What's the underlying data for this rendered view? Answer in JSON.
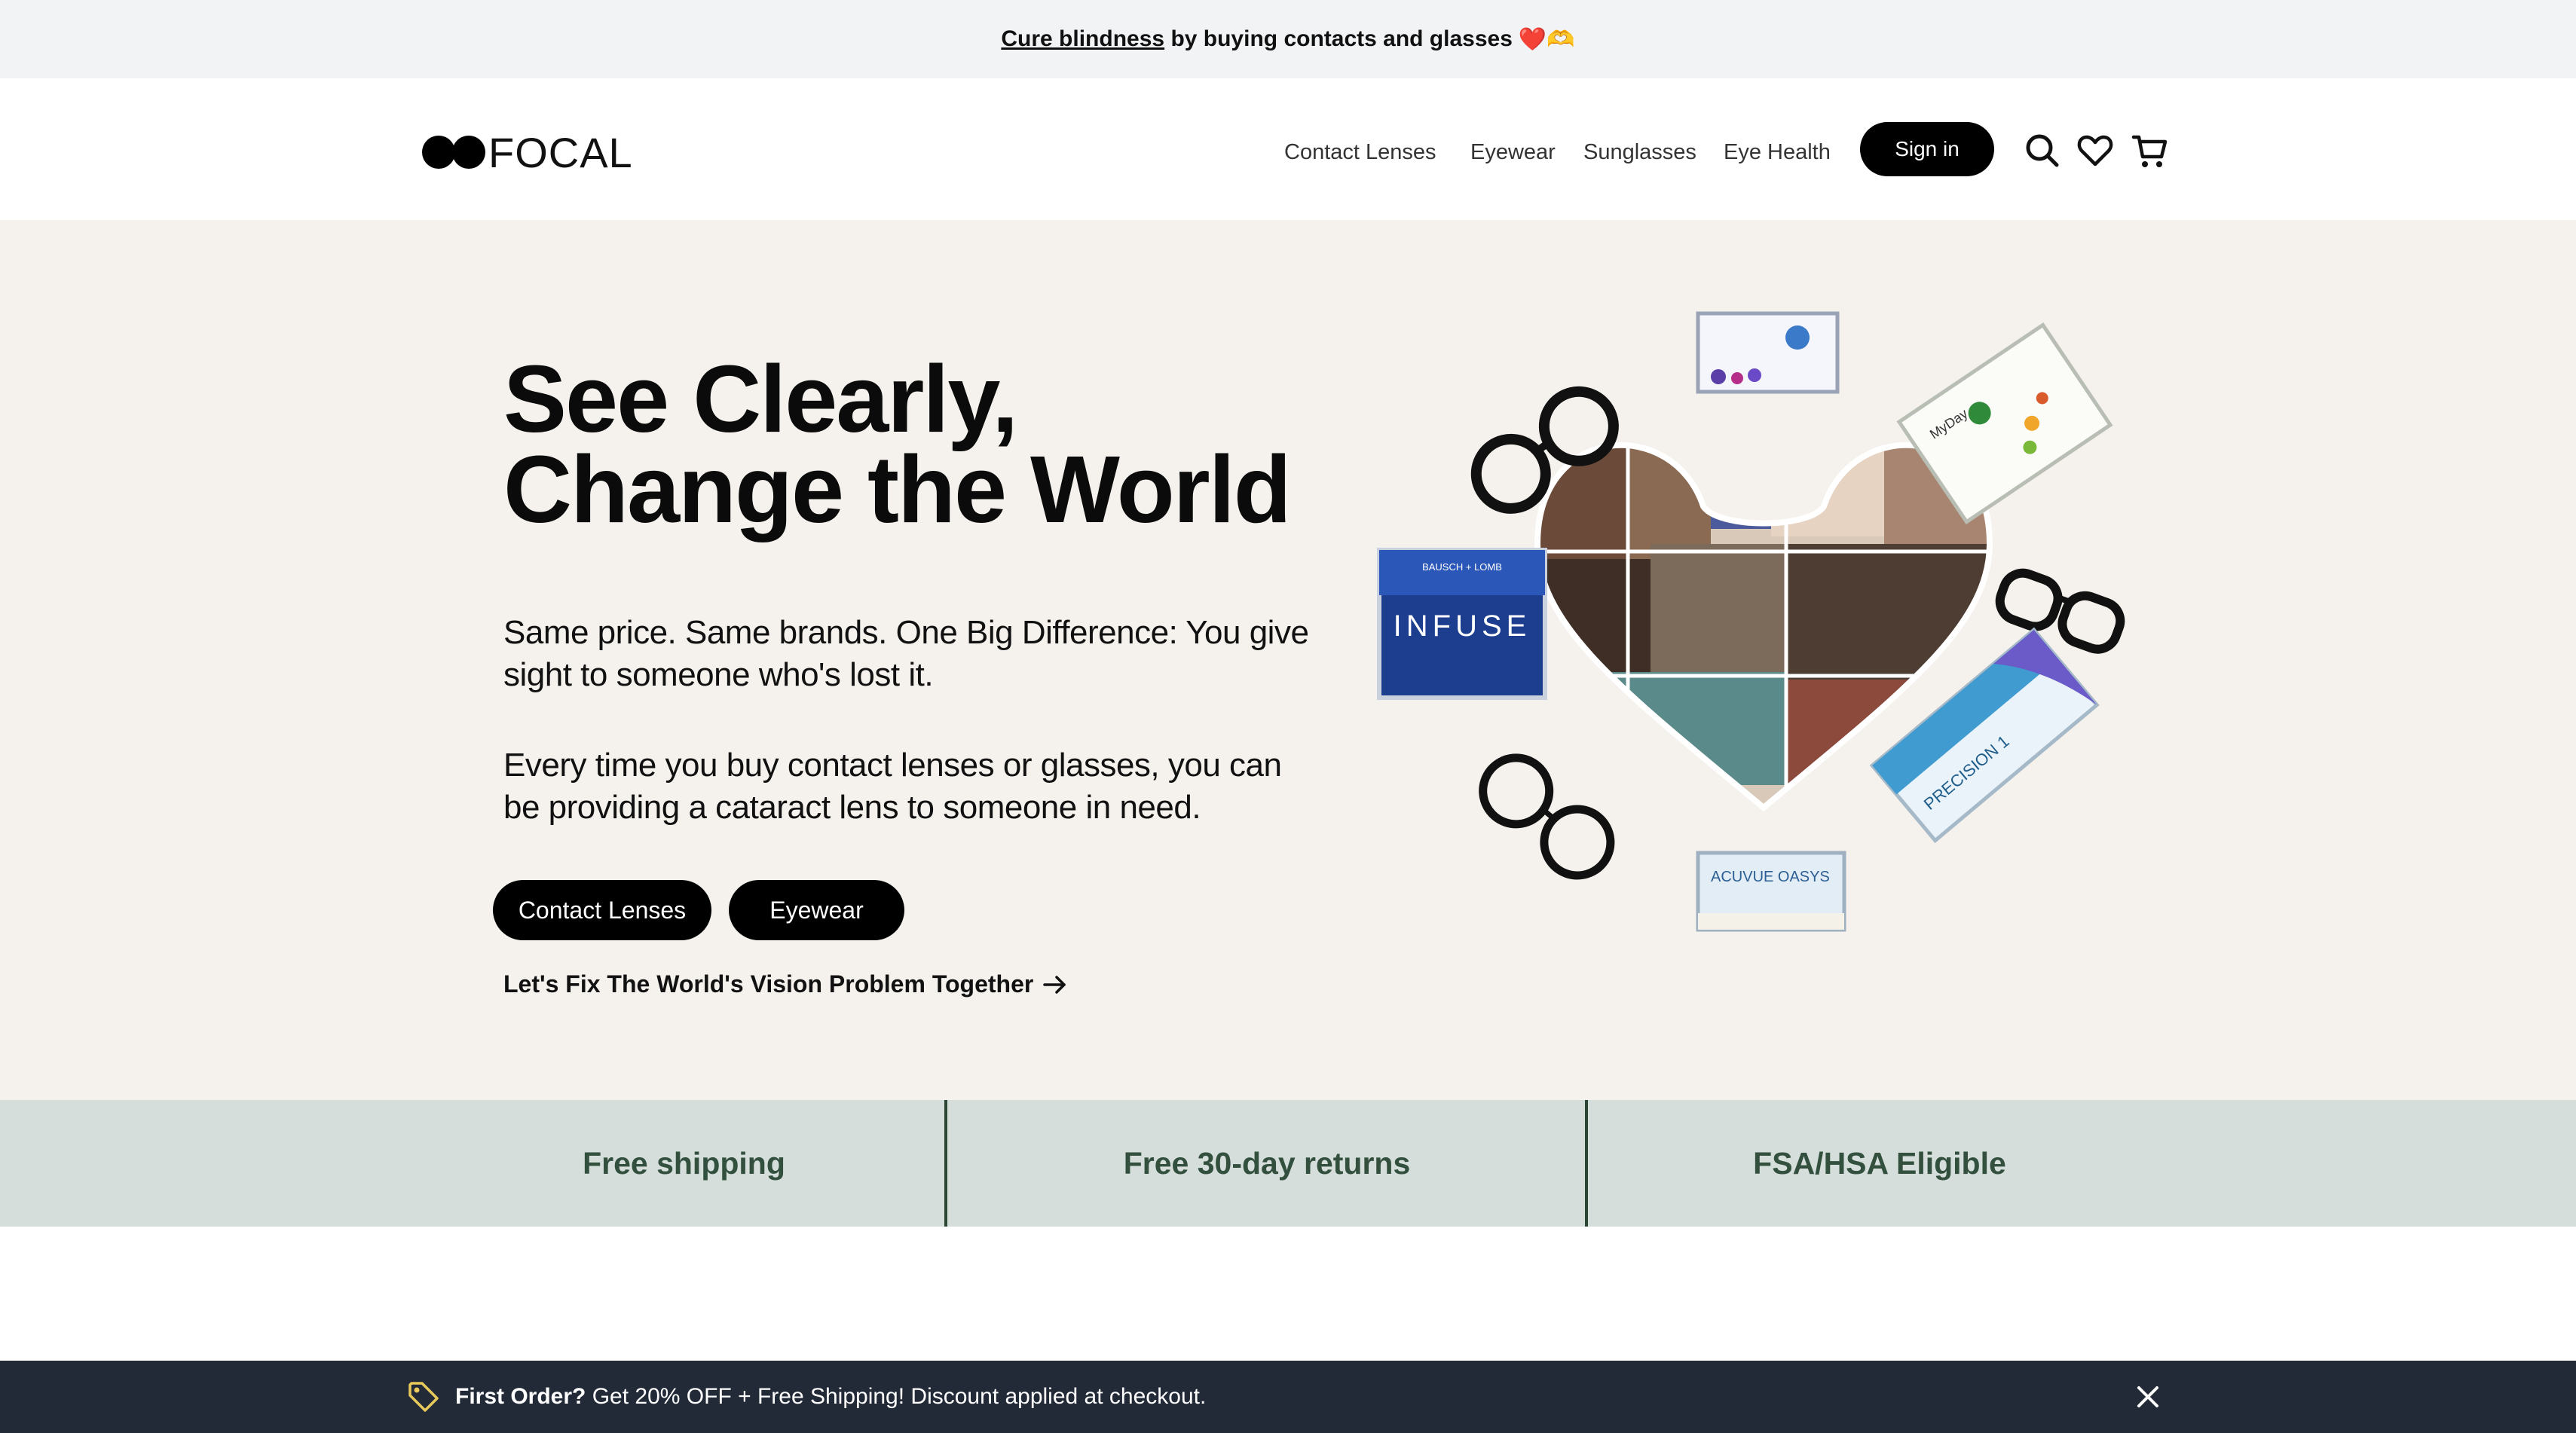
{
  "announcement": {
    "link_text": "Cure blindness",
    "text": "by buying contacts and glasses",
    "emoji": "❤️🫶"
  },
  "header": {
    "logo_text": "FOCAL",
    "nav": [
      "Contact Lenses",
      "Eyewear",
      "Sunglasses",
      "Eye Health"
    ],
    "signin_label": "Sign in",
    "icons": [
      "search-icon",
      "heart-icon",
      "cart-icon"
    ]
  },
  "hero": {
    "title_line1": "See Clearly,",
    "title_line2": "Change the World",
    "paragraph1": "Same price. Same brands. One Big Difference: You give sight to someone who's lost it.",
    "paragraph2": "Every time you buy contact lenses or glasses, you can be providing a cataract lens to someone in need.",
    "buttons": [
      "Contact Lenses",
      "Eyewear"
    ],
    "link": "Let's Fix The World's Vision Problem Together",
    "products": {
      "infuse_brand": "BAUSCH + LOMB",
      "infuse_name": "INFUSE",
      "myday": "MyDay",
      "precision": "PRECISION 1",
      "acuvue": "ACUVUE OASYS"
    }
  },
  "features": [
    "Free shipping",
    "Free 30-day returns",
    "FSA/HSA Eligible"
  ],
  "promo": {
    "bold": "First Order?",
    "text": "Get 20% OFF + Free Shipping! Discount applied at checkout."
  },
  "colors": {
    "announce_bg": "#f2f3f5",
    "hero_bg": "#f5f2ed",
    "feature_bg": "#d5dedb",
    "feature_text": "#33503f",
    "promo_bg": "#232a37",
    "promo_tag": "#e8c95a"
  }
}
